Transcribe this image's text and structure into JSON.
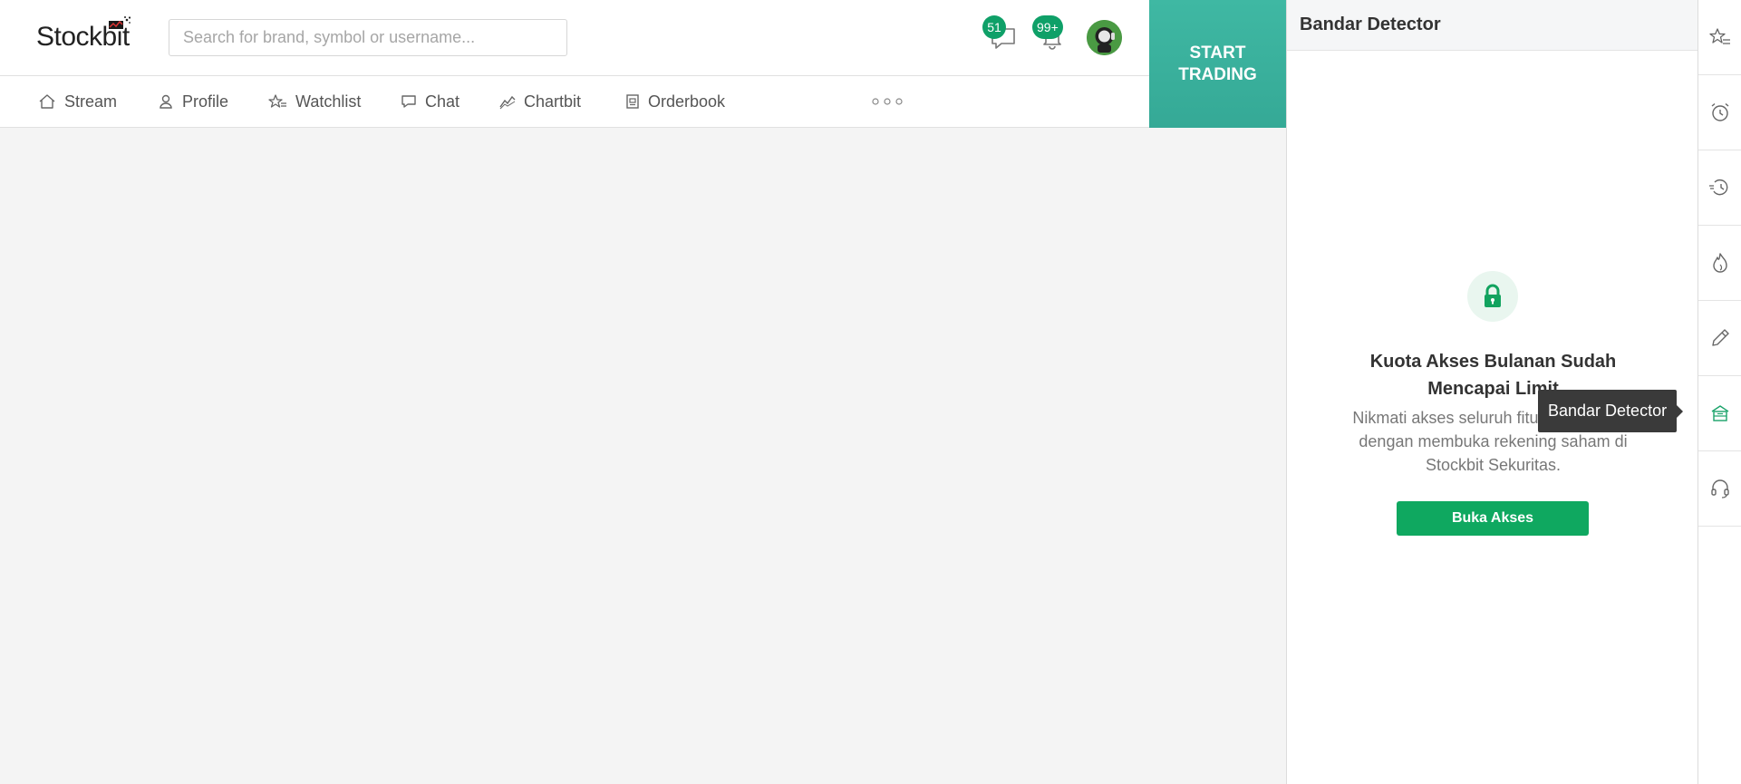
{
  "app": {
    "logo_text": "Stockbit"
  },
  "search": {
    "placeholder": "Search for brand, symbol or username..."
  },
  "header": {
    "messages_badge": "51",
    "notifications_badge": "99+",
    "start_trading_label": "START TRADING"
  },
  "nav": {
    "items": [
      {
        "label": "Stream",
        "icon": "home-icon"
      },
      {
        "label": "Profile",
        "icon": "user-icon"
      },
      {
        "label": "Watchlist",
        "icon": "star-list-icon"
      },
      {
        "label": "Chat",
        "icon": "chat-icon"
      },
      {
        "label": "Chartbit",
        "icon": "chart-line-icon"
      },
      {
        "label": "Orderbook",
        "icon": "orderbook-icon"
      }
    ],
    "more_icon": "more-dots-icon"
  },
  "panel": {
    "title": "Bandar Detector",
    "lock_icon": "lock-icon",
    "quota_title": "Kuota Akses Bulanan Sudah Mencapai Limit",
    "quota_desc": "Nikmati akses seluruh fitur tanpa batas dengan membuka rekening saham di Stockbit Sekuritas.",
    "button_label": "Buka Akses"
  },
  "rail": {
    "items": [
      {
        "name": "watchlist-rail-icon"
      },
      {
        "name": "alarm-icon"
      },
      {
        "name": "history-icon"
      },
      {
        "name": "fire-icon"
      },
      {
        "name": "pencil-icon"
      },
      {
        "name": "bandar-detector-icon",
        "active": true
      },
      {
        "name": "headset-icon"
      }
    ]
  },
  "tooltip": {
    "text": "Bandar Detector"
  },
  "colors": {
    "accent": "#0fa860",
    "start_trading": "#3fb8a3",
    "badge": "#0fa068",
    "main_bg": "#f4f4f4"
  }
}
